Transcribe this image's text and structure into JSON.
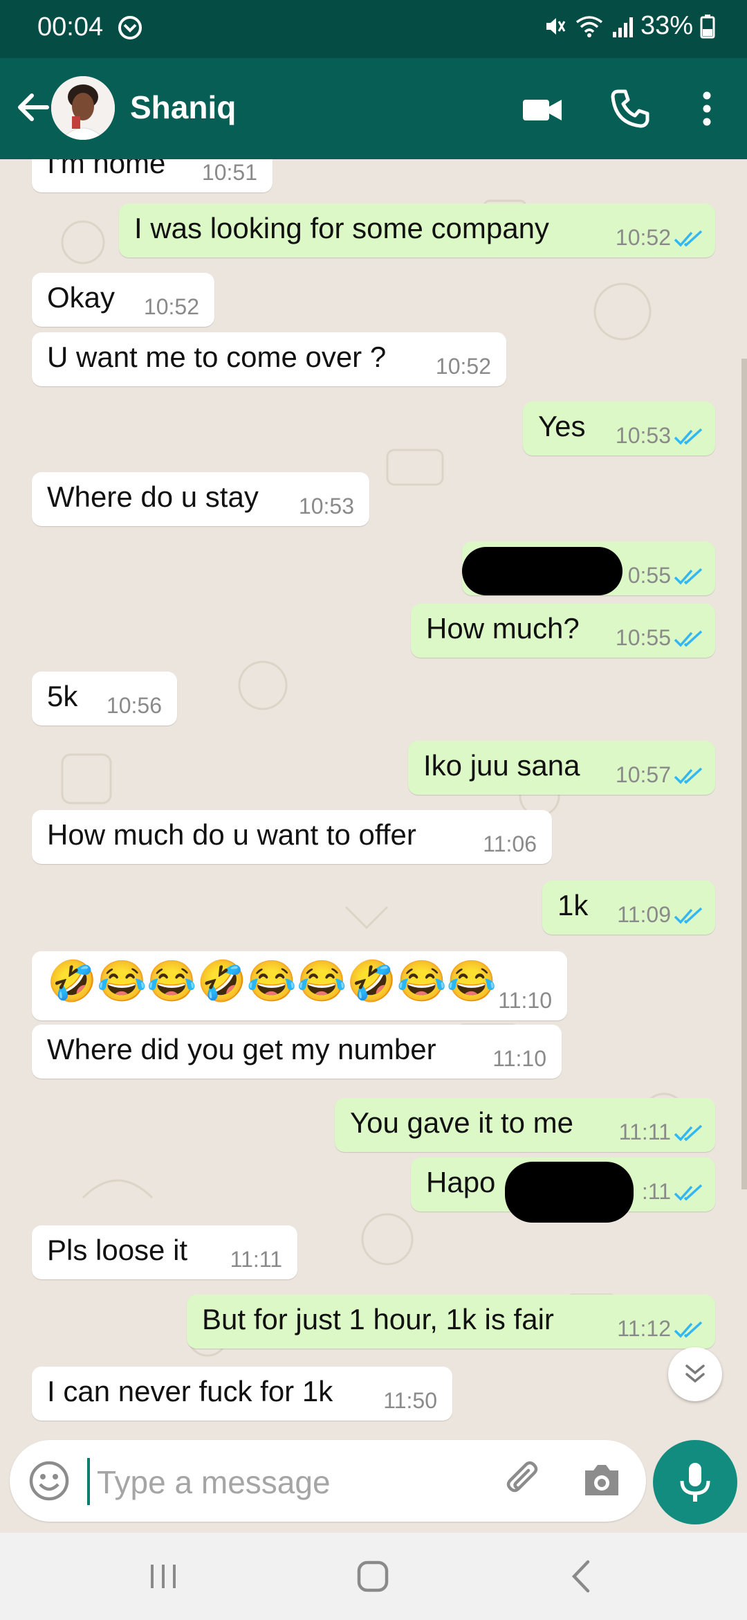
{
  "status_bar": {
    "time": "00:04",
    "battery": "33%"
  },
  "header": {
    "contact_name": "Shaniq"
  },
  "messages": [
    {
      "dir": "in",
      "text": "I'm home",
      "time": "10:51"
    },
    {
      "dir": "out",
      "text": "I was looking for some company",
      "time": "10:52"
    },
    {
      "dir": "in",
      "text": "Okay",
      "time": "10:52"
    },
    {
      "dir": "in",
      "text": "U want me to come over ?",
      "time": "10:52"
    },
    {
      "dir": "out",
      "text": "Yes",
      "time": "10:53"
    },
    {
      "dir": "in",
      "text": "Where do u stay",
      "time": "10:53"
    },
    {
      "dir": "out",
      "text": "",
      "time": "0:55"
    },
    {
      "dir": "out",
      "text": "How much?",
      "time": "10:55"
    },
    {
      "dir": "in",
      "text": "5k",
      "time": "10:56"
    },
    {
      "dir": "out",
      "text": "Iko juu sana",
      "time": "10:57"
    },
    {
      "dir": "in",
      "text": "How much do u want to offer",
      "time": "11:06"
    },
    {
      "dir": "out",
      "text": "1k",
      "time": "11:09"
    },
    {
      "dir": "in",
      "text": "🤣😂😂🤣😂😂🤣😂😂",
      "time": "11:10"
    },
    {
      "dir": "in",
      "text": "Where did you get my number",
      "time": "11:10"
    },
    {
      "dir": "out",
      "text": "You gave it to me",
      "time": "11:11"
    },
    {
      "dir": "out",
      "text": "Hapo",
      "time": ":11"
    },
    {
      "dir": "in",
      "text": "Pls loose it",
      "time": "11:11"
    },
    {
      "dir": "out",
      "text": "But for just 1 hour, 1k is fair",
      "time": "11:12"
    },
    {
      "dir": "in",
      "text": "I can never fuck for 1k",
      "time": "11:50"
    }
  ],
  "composer": {
    "placeholder": "Type a message"
  },
  "colors": {
    "header": "#075e54",
    "status_bar": "#054d44",
    "accent": "#128c7e",
    "outgoing_bubble": "#dcf8c6",
    "read_ticks": "#34b7f1",
    "chat_background": "#ece5dd"
  }
}
